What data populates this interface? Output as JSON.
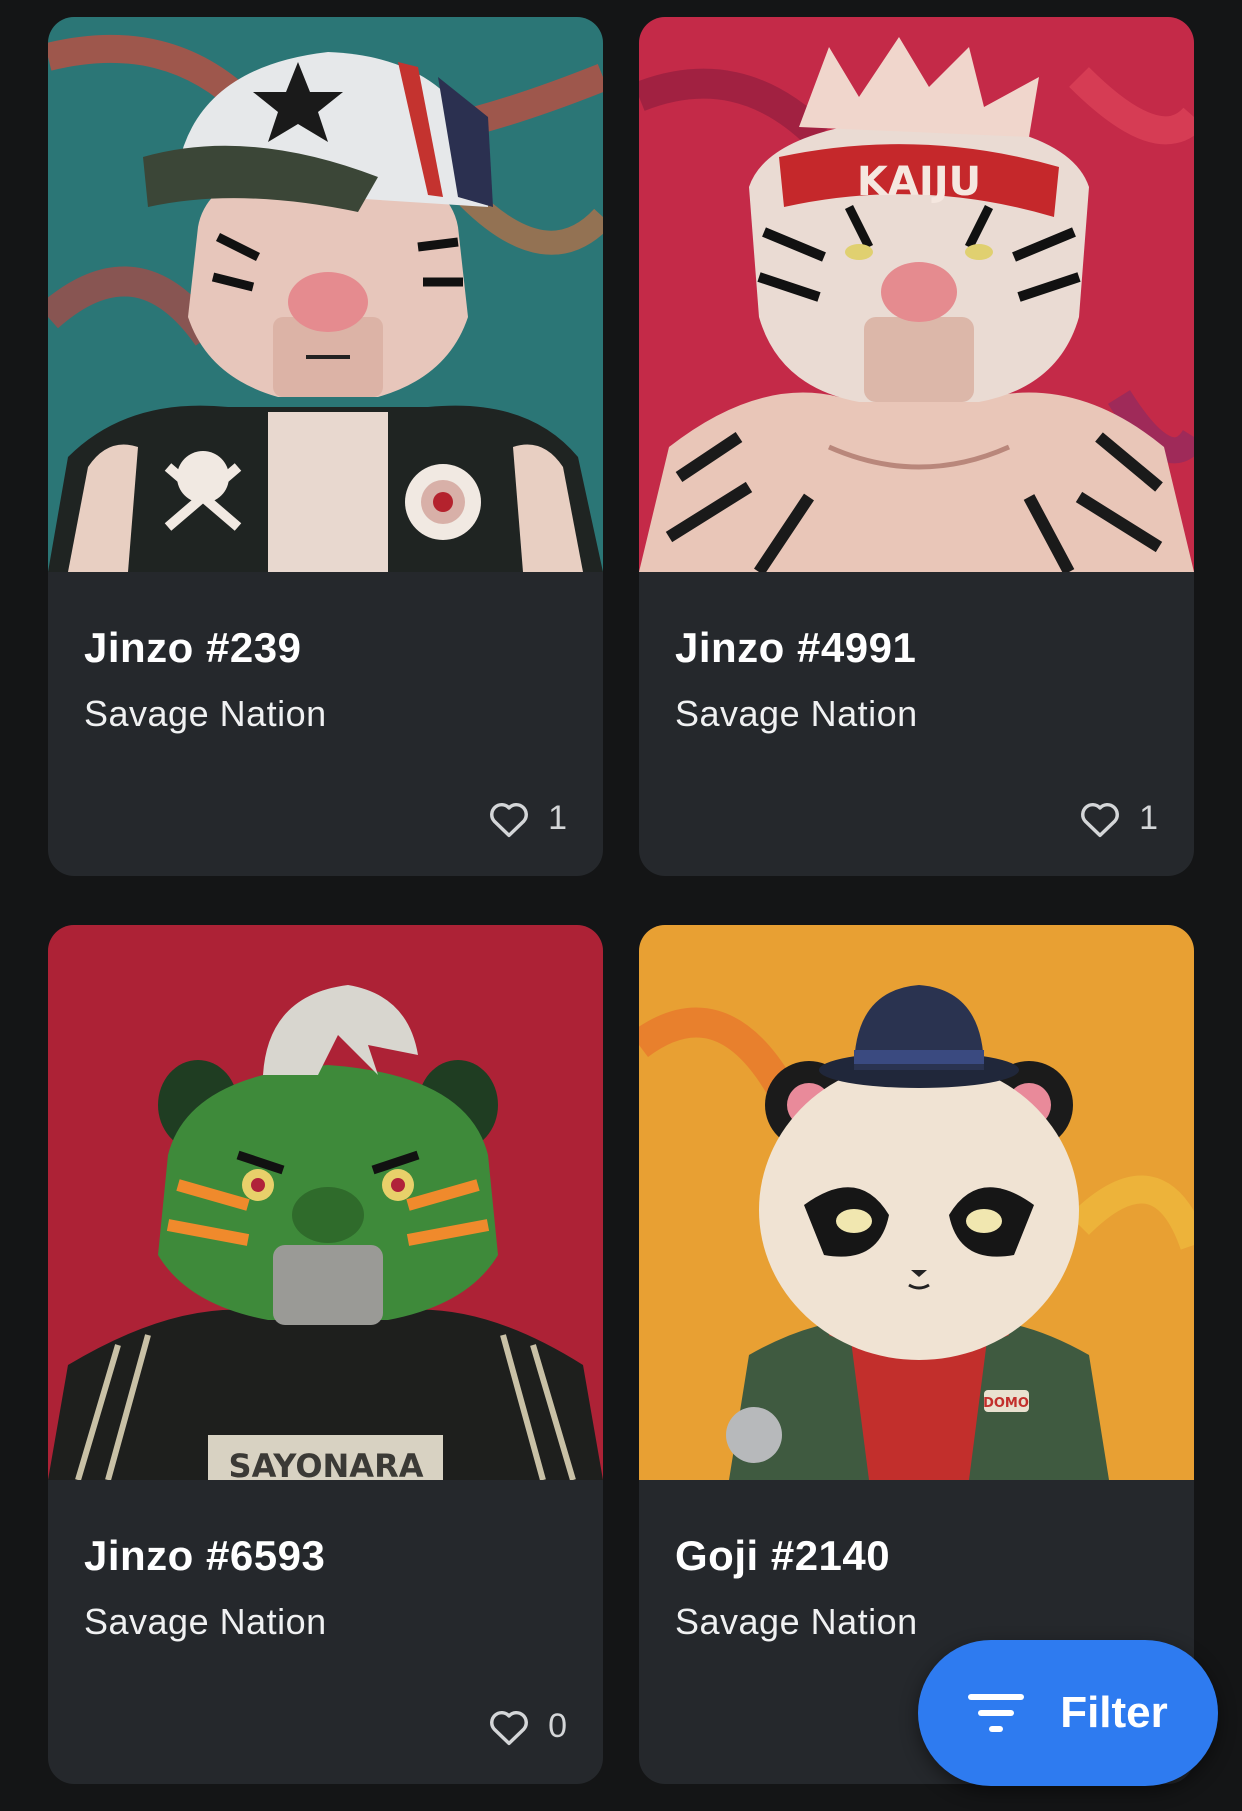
{
  "cards": [
    {
      "title": "Jinzo #239",
      "collection": "Savage Nation",
      "likes": "1",
      "art": "tiger-with-cap",
      "bg_color": "#2b7676"
    },
    {
      "title": "Jinzo #4991",
      "collection": "Savage Nation",
      "likes": "1",
      "art": "tiger-with-headband",
      "bg_color": "#c42a48",
      "headband_text": "KAIJU"
    },
    {
      "title": "Jinzo #6593",
      "collection": "Savage Nation",
      "likes": "0",
      "art": "green-tiger",
      "bg_color": "#ad2236",
      "shirt_text": "SAYONARA"
    },
    {
      "title": "Goji #2140",
      "collection": "Savage Nation",
      "art": "panda-with-bowler-hat",
      "bg_color": "#e8a033",
      "patch_text": "DOMO"
    }
  ],
  "filter_button": {
    "label": "Filter",
    "color": "#2e7bf0"
  }
}
